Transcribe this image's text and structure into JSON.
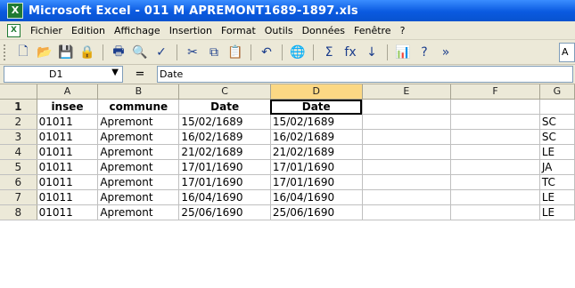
{
  "window": {
    "title": "Microsoft Excel - 011 M APREMONT1689-1897.xls"
  },
  "menu": [
    "Fichier",
    "Edition",
    "Affichage",
    "Insertion",
    "Format",
    "Outils",
    "Données",
    "Fenêtre",
    "?"
  ],
  "toolbar": {
    "buttons": [
      {
        "name": "new-icon",
        "glyph": "🗋"
      },
      {
        "name": "open-icon",
        "glyph": "📂"
      },
      {
        "name": "save-icon",
        "glyph": "💾"
      },
      {
        "name": "permission-icon",
        "glyph": "🔒"
      },
      {
        "name": "print-icon",
        "glyph": "🖶"
      },
      {
        "name": "print-preview-icon",
        "glyph": "🔍"
      },
      {
        "name": "spelling-icon",
        "glyph": "✓"
      },
      {
        "name": "cut-icon",
        "glyph": "✂"
      },
      {
        "name": "copy-icon",
        "glyph": "⧉"
      },
      {
        "name": "paste-icon",
        "glyph": "📋"
      },
      {
        "name": "undo-icon",
        "glyph": "↶"
      },
      {
        "name": "hyperlink-icon",
        "glyph": "🌐"
      },
      {
        "name": "autosum-icon",
        "glyph": "Σ"
      },
      {
        "name": "function-icon",
        "glyph": "fx"
      },
      {
        "name": "sort-ascending-icon",
        "glyph": "↓"
      },
      {
        "name": "chart-icon",
        "glyph": "📊"
      },
      {
        "name": "help-icon",
        "glyph": "?"
      },
      {
        "name": "more-icon",
        "glyph": "»"
      }
    ],
    "font_box": "A"
  },
  "formula_bar": {
    "name_box": "D1",
    "equals": "=",
    "content": "Date"
  },
  "sheet": {
    "columns": [
      "A",
      "B",
      "C",
      "D",
      "E",
      "F",
      "G"
    ],
    "selected_column": "D",
    "rows": [
      {
        "num": "1",
        "cells": [
          "insee",
          "commune",
          "Date",
          "Date",
          "",
          "",
          ""
        ],
        "header": true
      },
      {
        "num": "2",
        "cells": [
          "01011",
          "Apremont",
          "15/02/1689",
          "15/02/1689",
          "",
          "",
          "SC"
        ]
      },
      {
        "num": "3",
        "cells": [
          "01011",
          "Apremont",
          "16/02/1689",
          "16/02/1689",
          "",
          "",
          "SC"
        ]
      },
      {
        "num": "4",
        "cells": [
          "01011",
          "Apremont",
          "21/02/1689",
          "21/02/1689",
          "",
          "",
          "LE"
        ]
      },
      {
        "num": "5",
        "cells": [
          "01011",
          "Apremont",
          "17/01/1690",
          "17/01/1690",
          "",
          "",
          "JA"
        ]
      },
      {
        "num": "6",
        "cells": [
          "01011",
          "Apremont",
          "17/01/1690",
          "17/01/1690",
          "",
          "",
          "TC"
        ]
      },
      {
        "num": "7",
        "cells": [
          "01011",
          "Apremont",
          "16/04/1690",
          "16/04/1690",
          "",
          "",
          "LE"
        ]
      },
      {
        "num": "8",
        "cells": [
          "01011",
          "Apremont",
          "25/06/1690",
          "25/06/1690",
          "",
          "",
          "LE"
        ]
      }
    ]
  }
}
